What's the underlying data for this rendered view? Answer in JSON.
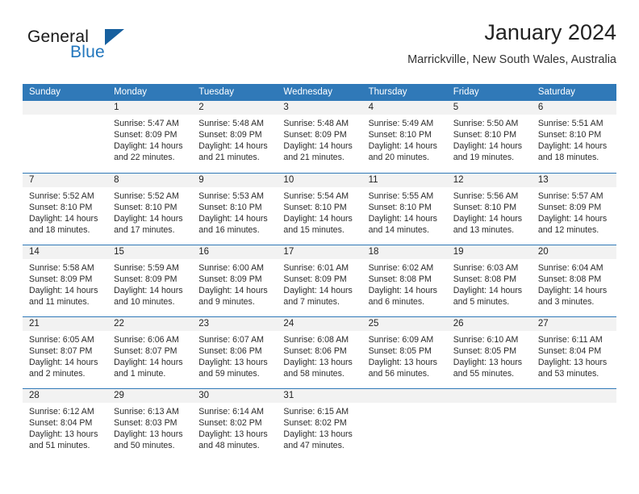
{
  "logo": {
    "word_top": "General",
    "word_bottom": "Blue",
    "triangle_color": "#17609f",
    "blue_color": "#2176bd"
  },
  "header": {
    "title": "January 2024",
    "subtitle": "Marrickville, New South Wales, Australia"
  },
  "theme": {
    "header_blue": "#3079b8",
    "day_band_gray": "#f2f2f2"
  },
  "weekdays": [
    "Sunday",
    "Monday",
    "Tuesday",
    "Wednesday",
    "Thursday",
    "Friday",
    "Saturday"
  ],
  "weeks": [
    [
      {
        "day": "",
        "sunrise": "",
        "sunset": "",
        "daylight1": "",
        "daylight2": ""
      },
      {
        "day": "1",
        "sunrise": "Sunrise: 5:47 AM",
        "sunset": "Sunset: 8:09 PM",
        "daylight1": "Daylight: 14 hours",
        "daylight2": "and 22 minutes."
      },
      {
        "day": "2",
        "sunrise": "Sunrise: 5:48 AM",
        "sunset": "Sunset: 8:09 PM",
        "daylight1": "Daylight: 14 hours",
        "daylight2": "and 21 minutes."
      },
      {
        "day": "3",
        "sunrise": "Sunrise: 5:48 AM",
        "sunset": "Sunset: 8:09 PM",
        "daylight1": "Daylight: 14 hours",
        "daylight2": "and 21 minutes."
      },
      {
        "day": "4",
        "sunrise": "Sunrise: 5:49 AM",
        "sunset": "Sunset: 8:10 PM",
        "daylight1": "Daylight: 14 hours",
        "daylight2": "and 20 minutes."
      },
      {
        "day": "5",
        "sunrise": "Sunrise: 5:50 AM",
        "sunset": "Sunset: 8:10 PM",
        "daylight1": "Daylight: 14 hours",
        "daylight2": "and 19 minutes."
      },
      {
        "day": "6",
        "sunrise": "Sunrise: 5:51 AM",
        "sunset": "Sunset: 8:10 PM",
        "daylight1": "Daylight: 14 hours",
        "daylight2": "and 18 minutes."
      }
    ],
    [
      {
        "day": "7",
        "sunrise": "Sunrise: 5:52 AM",
        "sunset": "Sunset: 8:10 PM",
        "daylight1": "Daylight: 14 hours",
        "daylight2": "and 18 minutes."
      },
      {
        "day": "8",
        "sunrise": "Sunrise: 5:52 AM",
        "sunset": "Sunset: 8:10 PM",
        "daylight1": "Daylight: 14 hours",
        "daylight2": "and 17 minutes."
      },
      {
        "day": "9",
        "sunrise": "Sunrise: 5:53 AM",
        "sunset": "Sunset: 8:10 PM",
        "daylight1": "Daylight: 14 hours",
        "daylight2": "and 16 minutes."
      },
      {
        "day": "10",
        "sunrise": "Sunrise: 5:54 AM",
        "sunset": "Sunset: 8:10 PM",
        "daylight1": "Daylight: 14 hours",
        "daylight2": "and 15 minutes."
      },
      {
        "day": "11",
        "sunrise": "Sunrise: 5:55 AM",
        "sunset": "Sunset: 8:10 PM",
        "daylight1": "Daylight: 14 hours",
        "daylight2": "and 14 minutes."
      },
      {
        "day": "12",
        "sunrise": "Sunrise: 5:56 AM",
        "sunset": "Sunset: 8:10 PM",
        "daylight1": "Daylight: 14 hours",
        "daylight2": "and 13 minutes."
      },
      {
        "day": "13",
        "sunrise": "Sunrise: 5:57 AM",
        "sunset": "Sunset: 8:09 PM",
        "daylight1": "Daylight: 14 hours",
        "daylight2": "and 12 minutes."
      }
    ],
    [
      {
        "day": "14",
        "sunrise": "Sunrise: 5:58 AM",
        "sunset": "Sunset: 8:09 PM",
        "daylight1": "Daylight: 14 hours",
        "daylight2": "and 11 minutes."
      },
      {
        "day": "15",
        "sunrise": "Sunrise: 5:59 AM",
        "sunset": "Sunset: 8:09 PM",
        "daylight1": "Daylight: 14 hours",
        "daylight2": "and 10 minutes."
      },
      {
        "day": "16",
        "sunrise": "Sunrise: 6:00 AM",
        "sunset": "Sunset: 8:09 PM",
        "daylight1": "Daylight: 14 hours",
        "daylight2": "and 9 minutes."
      },
      {
        "day": "17",
        "sunrise": "Sunrise: 6:01 AM",
        "sunset": "Sunset: 8:09 PM",
        "daylight1": "Daylight: 14 hours",
        "daylight2": "and 7 minutes."
      },
      {
        "day": "18",
        "sunrise": "Sunrise: 6:02 AM",
        "sunset": "Sunset: 8:08 PM",
        "daylight1": "Daylight: 14 hours",
        "daylight2": "and 6 minutes."
      },
      {
        "day": "19",
        "sunrise": "Sunrise: 6:03 AM",
        "sunset": "Sunset: 8:08 PM",
        "daylight1": "Daylight: 14 hours",
        "daylight2": "and 5 minutes."
      },
      {
        "day": "20",
        "sunrise": "Sunrise: 6:04 AM",
        "sunset": "Sunset: 8:08 PM",
        "daylight1": "Daylight: 14 hours",
        "daylight2": "and 3 minutes."
      }
    ],
    [
      {
        "day": "21",
        "sunrise": "Sunrise: 6:05 AM",
        "sunset": "Sunset: 8:07 PM",
        "daylight1": "Daylight: 14 hours",
        "daylight2": "and 2 minutes."
      },
      {
        "day": "22",
        "sunrise": "Sunrise: 6:06 AM",
        "sunset": "Sunset: 8:07 PM",
        "daylight1": "Daylight: 14 hours",
        "daylight2": "and 1 minute."
      },
      {
        "day": "23",
        "sunrise": "Sunrise: 6:07 AM",
        "sunset": "Sunset: 8:06 PM",
        "daylight1": "Daylight: 13 hours",
        "daylight2": "and 59 minutes."
      },
      {
        "day": "24",
        "sunrise": "Sunrise: 6:08 AM",
        "sunset": "Sunset: 8:06 PM",
        "daylight1": "Daylight: 13 hours",
        "daylight2": "and 58 minutes."
      },
      {
        "day": "25",
        "sunrise": "Sunrise: 6:09 AM",
        "sunset": "Sunset: 8:05 PM",
        "daylight1": "Daylight: 13 hours",
        "daylight2": "and 56 minutes."
      },
      {
        "day": "26",
        "sunrise": "Sunrise: 6:10 AM",
        "sunset": "Sunset: 8:05 PM",
        "daylight1": "Daylight: 13 hours",
        "daylight2": "and 55 minutes."
      },
      {
        "day": "27",
        "sunrise": "Sunrise: 6:11 AM",
        "sunset": "Sunset: 8:04 PM",
        "daylight1": "Daylight: 13 hours",
        "daylight2": "and 53 minutes."
      }
    ],
    [
      {
        "day": "28",
        "sunrise": "Sunrise: 6:12 AM",
        "sunset": "Sunset: 8:04 PM",
        "daylight1": "Daylight: 13 hours",
        "daylight2": "and 51 minutes."
      },
      {
        "day": "29",
        "sunrise": "Sunrise: 6:13 AM",
        "sunset": "Sunset: 8:03 PM",
        "daylight1": "Daylight: 13 hours",
        "daylight2": "and 50 minutes."
      },
      {
        "day": "30",
        "sunrise": "Sunrise: 6:14 AM",
        "sunset": "Sunset: 8:02 PM",
        "daylight1": "Daylight: 13 hours",
        "daylight2": "and 48 minutes."
      },
      {
        "day": "31",
        "sunrise": "Sunrise: 6:15 AM",
        "sunset": "Sunset: 8:02 PM",
        "daylight1": "Daylight: 13 hours",
        "daylight2": "and 47 minutes."
      },
      {
        "day": "",
        "sunrise": "",
        "sunset": "",
        "daylight1": "",
        "daylight2": ""
      },
      {
        "day": "",
        "sunrise": "",
        "sunset": "",
        "daylight1": "",
        "daylight2": ""
      },
      {
        "day": "",
        "sunrise": "",
        "sunset": "",
        "daylight1": "",
        "daylight2": ""
      }
    ]
  ]
}
